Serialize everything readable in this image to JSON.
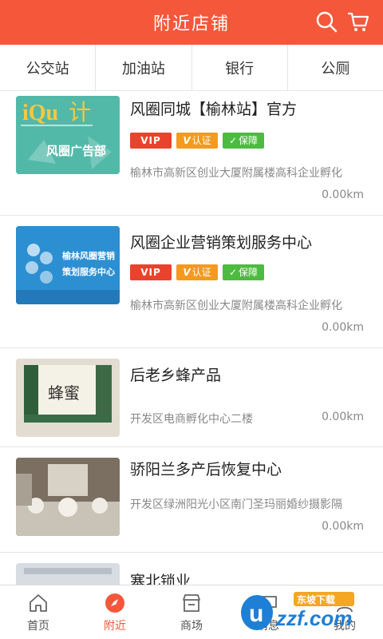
{
  "header": {
    "title": "附近店铺"
  },
  "categories": [
    "公交站",
    "加油站",
    "银行",
    "公厕"
  ],
  "badges": {
    "vip": "VIP",
    "cert": "认证",
    "guarantee": "保障"
  },
  "stores": [
    {
      "name": "风圈同城【榆林站】官方",
      "address": "榆林市高新区创业大厦附属楼高科企业孵化",
      "distance": "0.00km",
      "thumb_text": "风圈广告部"
    },
    {
      "name": "风圈企业营销策划服务中心",
      "address": "榆林市高新区创业大厦附属楼高科企业孵化",
      "distance": "0.00km",
      "thumb_text": "榆林风圈营销策划服务中心"
    },
    {
      "name": "后老乡蜂产品",
      "address": "开发区电商孵化中心二楼",
      "distance": "0.00km"
    },
    {
      "name": "骄阳兰多产后恢复中心",
      "address": "开发区绿洲阳光小区南门圣玛丽婚纱摄影隔",
      "distance": "0.00km"
    },
    {
      "name": "塞北锁业"
    }
  ],
  "tabs": [
    {
      "label": "首页",
      "icon": "home-icon"
    },
    {
      "label": "附近",
      "icon": "compass-icon",
      "active": true
    },
    {
      "label": "商场",
      "icon": "store-icon"
    },
    {
      "label": "消息",
      "icon": "message-icon"
    },
    {
      "label": "我的",
      "icon": "user-icon"
    }
  ],
  "colors": {
    "accent": "#f5573b",
    "vip": "#e8432c",
    "cert": "#f39a1f",
    "guarantee": "#4cbb3f"
  },
  "watermark": {
    "brand": "uzzf.com",
    "tag": "东坡下载"
  }
}
